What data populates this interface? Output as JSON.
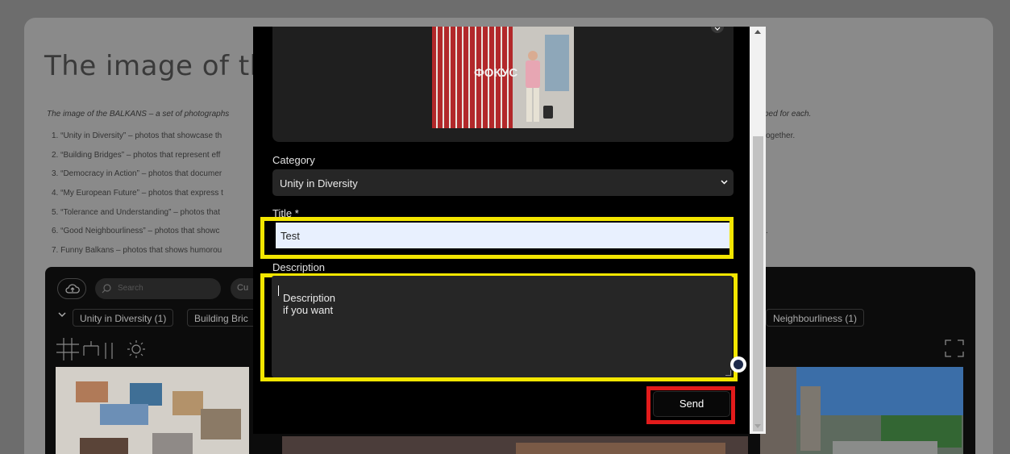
{
  "background": {
    "title": "The image of the B",
    "intro": "The image of the BALKANS – a set of photographs",
    "intro_right": "ped for each.",
    "rules": [
      "1. “Unity in Diversity” – photos that showcase th",
      "2. “Building Bridges” – photos that represent eff",
      "3. “Democracy in Action” – photos that documer",
      "4. “My European Future” – photos that express t",
      "5. “Tolerance and Understanding” – photos that",
      "6. “Good Neighbourliness” – photos that showc",
      "7. Funny Balkans – photos that shows humorou"
    ],
    "rule1_right": "ogether.",
    "rule6_right": ".",
    "gallery": {
      "search_placeholder": "Search",
      "cur_button": "Cu",
      "chips": [
        "Unity in Diversity (1)",
        "Building Bric",
        "Neighbourliness (1)"
      ]
    }
  },
  "modal": {
    "category_label": "Category",
    "category_value": "Unity in Diversity",
    "title_label": "Title *",
    "title_value": "Test",
    "description_label": "Description",
    "description_value": "Description if you want",
    "send_label": "Send",
    "photo_sign_text": "ФОКУС"
  },
  "colors": {
    "highlight_yellow": "#f3e600",
    "highlight_red": "#e21b1b",
    "autofill_blue": "#e8f0fe"
  }
}
